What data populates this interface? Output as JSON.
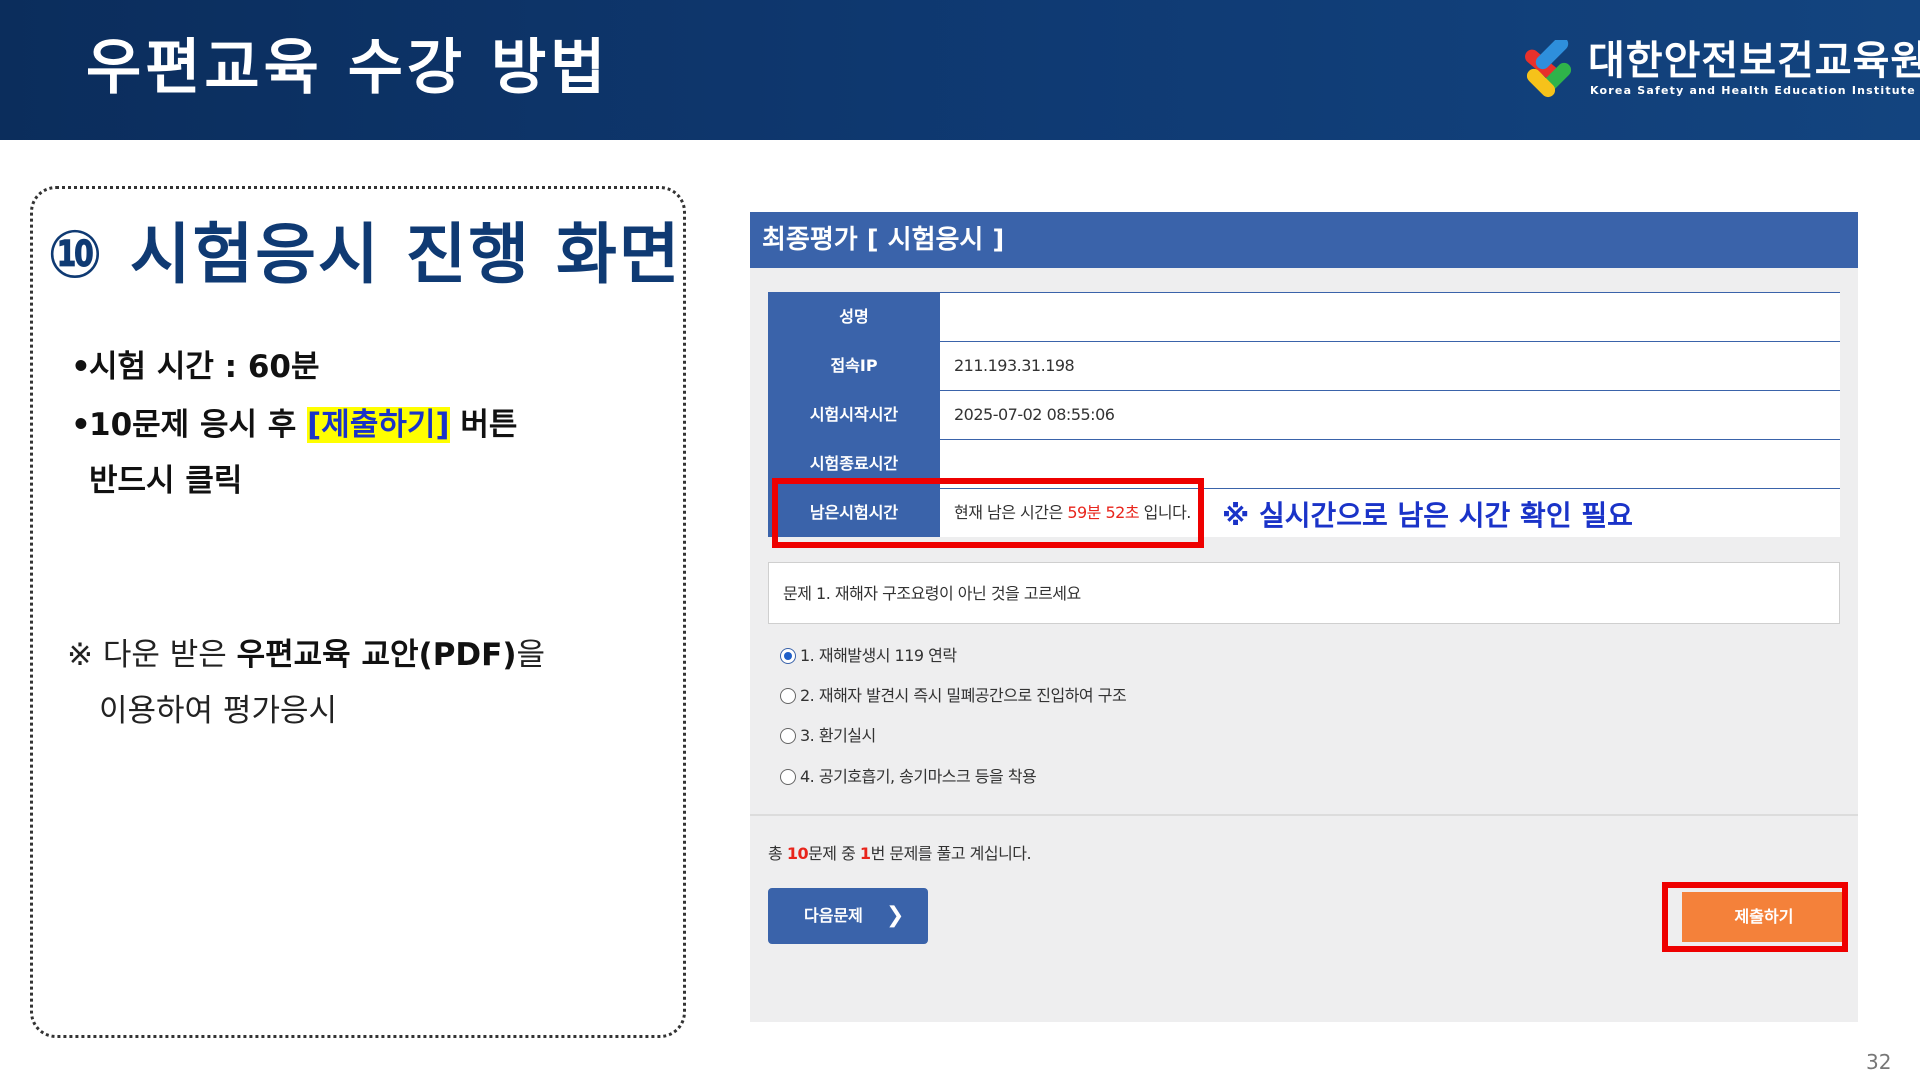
{
  "header": {
    "title": "우편교육 수강 방법",
    "org_name": "대한안전보건교육원",
    "org_subtitle": "Korea Safety and Health Education Institute"
  },
  "left": {
    "section_title": "⑩ 시험응시 진행 화면",
    "bullet1": "시험 시간 : 60분",
    "bullet2_pre": "10문제 응시 후 ",
    "bullet2_highlight": "[제출하기]",
    "bullet2_post": " 버튼",
    "bullet2_line2": "반드시 클릭",
    "note_pre": "※ 다운 받은 ",
    "note_bold": "우편교육 교안(PDF)",
    "note_post": "을",
    "note_line2": "이용하여 평가응시"
  },
  "exam": {
    "title": "최종평가 [ 시험응시 ]",
    "rows": [
      {
        "label": "성명",
        "value": ""
      },
      {
        "label": "접속IP",
        "value": "211.193.31.198"
      },
      {
        "label": "시험시작시간",
        "value": "2025-07-02 08:55:06"
      },
      {
        "label": "시험종료시간",
        "value": ""
      }
    ],
    "remain_label": "남은시험시간",
    "remain_pre": "현재 남은 시간은 ",
    "remain_time": "59분 52초",
    "remain_post": " 입니다.",
    "realtime_note": "※ 실시간으로 남은 시간 확인 필요",
    "question": "문제 1. 재해자 구조요령이 아닌 것을 고르세요",
    "options": [
      {
        "label": "1. 재해발생시 119 연락",
        "checked": true
      },
      {
        "label": "2. 재해자 발견시 즉시 밀폐공간으로 진입하여 구조",
        "checked": false
      },
      {
        "label": "3. 환기실시",
        "checked": false
      },
      {
        "label": "4. 공기호흡기, 송기마스크 등을 착용",
        "checked": false
      }
    ],
    "progress_pre": "총 ",
    "progress_total": "10",
    "progress_mid": "문제 중 ",
    "progress_current": "1",
    "progress_post": "번 문제를 풀고 계십니다.",
    "next_label": "다음문제",
    "submit_label": "제출하기"
  },
  "page_number": "32",
  "colors": {
    "header_bg": "#0f3a73",
    "panel_blue": "#3a63aa",
    "highlight_red": "#ee0000",
    "submit_orange": "#f4813a",
    "note_blue": "#1a33c8"
  },
  "icons": {
    "logo": "kshei-logo-icon",
    "next": "chevron-right-icon",
    "radio": "radio-icon"
  }
}
